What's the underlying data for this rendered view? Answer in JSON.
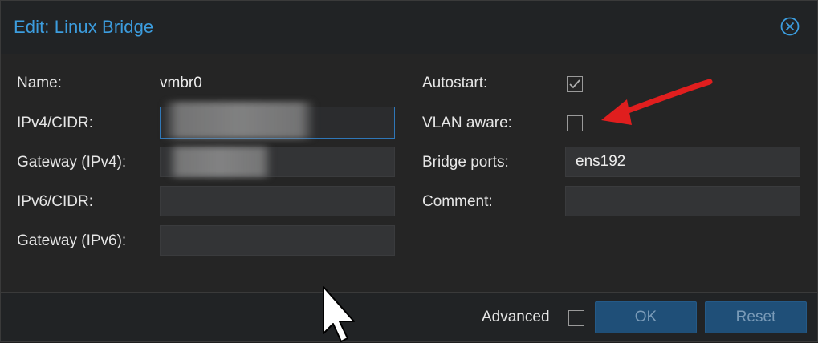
{
  "dialog": {
    "title": "Edit: Linux Bridge",
    "close_icon": "close-circle-icon"
  },
  "left": {
    "name_label": "Name:",
    "name_value": "vmbr0",
    "ipv4_label": "IPv4/CIDR:",
    "ipv4_value": "",
    "gateway4_label": "Gateway (IPv4):",
    "gateway4_value": "",
    "ipv6_label": "IPv6/CIDR:",
    "ipv6_value": "",
    "gateway6_label": "Gateway (IPv6):",
    "gateway6_value": ""
  },
  "right": {
    "autostart_label": "Autostart:",
    "autostart_checked": true,
    "vlan_label": "VLAN aware:",
    "vlan_checked": false,
    "bridge_ports_label": "Bridge ports:",
    "bridge_ports_value": "ens192",
    "comment_label": "Comment:",
    "comment_value": ""
  },
  "footer": {
    "advanced_label": "Advanced",
    "advanced_checked": false,
    "ok_label": "OK",
    "reset_label": "Reset"
  },
  "colors": {
    "title": "#3c9ddf",
    "button_bg": "#1f4f78",
    "button_text": "#7a9bb8",
    "annotation_arrow": "#e01e1e"
  }
}
